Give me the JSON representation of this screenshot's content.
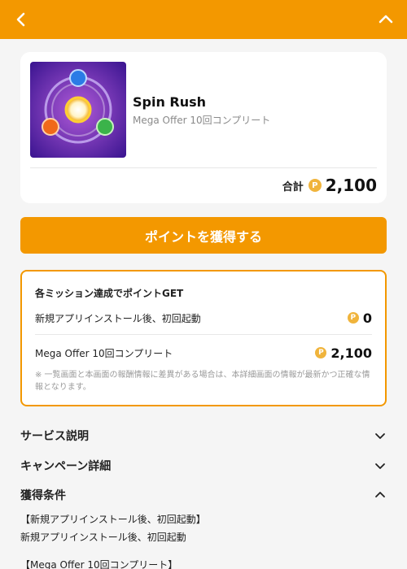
{
  "header": {
    "back_icon": "chevron-left-icon",
    "collapse_icon": "chevron-up-icon",
    "bg_color": "#f39800"
  },
  "app": {
    "icon": "spin-rush-app-icon",
    "title": "Spin Rush",
    "subtitle": "Mega Offer 10回コンプリート",
    "total_label": "合計",
    "total_points": "2,100",
    "coin_glyph": "P"
  },
  "cta": {
    "label": "ポイントを獲得する"
  },
  "missions": {
    "heading": "各ミッション達成でポイントGET",
    "items": [
      {
        "label": "新規アプリインストール後、初回起動",
        "points": "0"
      },
      {
        "label": "Mega Offer 10回コンプリート",
        "points": "2,100"
      }
    ],
    "note": "※ 一覧画面と本画面の報酬情報に差異がある場合は、本詳細画面の情報が最新かつ正確な情報となります。"
  },
  "sections": [
    {
      "title": "サービス説明",
      "state": "collapsed"
    },
    {
      "title": "キャンペーン詳細",
      "state": "collapsed"
    },
    {
      "title": "獲得条件",
      "state": "expanded"
    }
  ],
  "conditions": {
    "line1": "【新規アプリインストール後、初回起動】",
    "line2": "新規アプリインストール後、初回起動",
    "line3": "【Mega Offer 10回コンプリート】"
  }
}
